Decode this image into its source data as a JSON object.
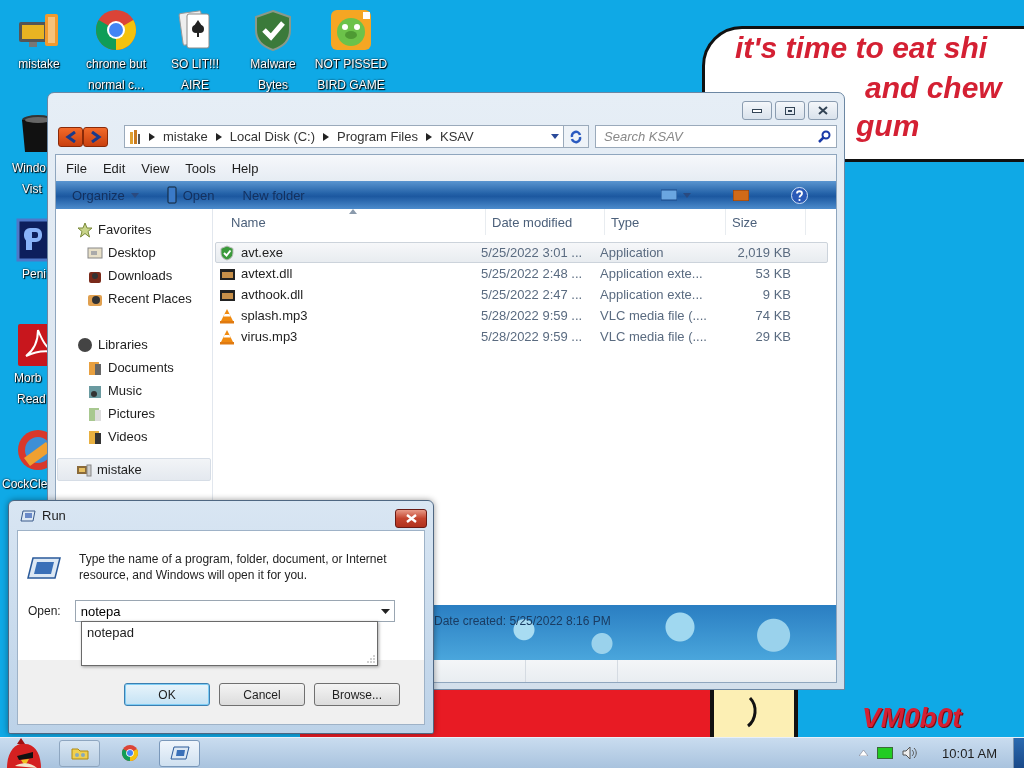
{
  "wallpaper": {
    "bubble_lines": [
      "it's time to eat shi",
      "and chew",
      "gum"
    ],
    "signature": "VM0b0t"
  },
  "desktop_icons": [
    {
      "kind": "computer",
      "lines": [
        "mistake"
      ]
    },
    {
      "kind": "chrome",
      "lines": [
        "chrome but",
        "normal c..."
      ]
    },
    {
      "kind": "cards",
      "lines": [
        "SO LIT!!!",
        "AIRE"
      ]
    },
    {
      "kind": "shield",
      "lines": [
        "Malware",
        "Bytes"
      ]
    },
    {
      "kind": "pig",
      "lines": [
        "NOT PISSED",
        "BIRD GAME"
      ]
    },
    {
      "kind": "bin",
      "lines": [
        "Windo",
        "Vist"
      ]
    },
    {
      "kind": "ps",
      "lines": [
        "Peni"
      ]
    },
    {
      "kind": "pdf",
      "lines": [
        "Morb",
        "Read"
      ]
    },
    {
      "kind": "cleaner",
      "lines": [
        "CockCle"
      ]
    }
  ],
  "explorer": {
    "breadcrumb": [
      "mistake",
      "Local Disk (C:)",
      "Program Files",
      "KSAV"
    ],
    "search": {
      "placeholder": "Search KSAV"
    },
    "menu": [
      "File",
      "Edit",
      "View",
      "Tools",
      "Help"
    ],
    "toolbar": [
      {
        "label": "Organize",
        "kind": "menu"
      },
      {
        "label": "Open",
        "kind": "open"
      },
      {
        "label": "New folder",
        "kind": "plain"
      }
    ],
    "nav": [
      {
        "label": "Favorites",
        "kind": "star",
        "selected": false,
        "children": [
          {
            "label": "Desktop",
            "kind": "desktop",
            "selected": false
          },
          {
            "label": "Downloads",
            "kind": "downloads",
            "selected": false
          },
          {
            "label": "Recent Places",
            "kind": "recent",
            "selected": false
          }
        ]
      },
      {
        "label": "Libraries",
        "kind": "libraries",
        "selected": false,
        "children": [
          {
            "label": "Documents",
            "kind": "documents",
            "selected": false
          },
          {
            "label": "Music",
            "kind": "music",
            "selected": false
          },
          {
            "label": "Pictures",
            "kind": "pictures",
            "selected": false
          },
          {
            "label": "Videos",
            "kind": "videos",
            "selected": false
          }
        ]
      },
      {
        "label": "mistake",
        "kind": "computer",
        "selected": true
      }
    ],
    "columns": [
      "Name",
      "Date modified",
      "Type",
      "Size"
    ],
    "files": [
      {
        "name": "avt.exe",
        "date": "5/25/2022 3:01 ...",
        "type": "Application",
        "size": "2,019 KB",
        "kind": "exe",
        "selected": true
      },
      {
        "name": "avtext.dll",
        "date": "5/25/2022 2:48 ...",
        "type": "Application exte...",
        "size": "53 KB",
        "kind": "dll",
        "selected": false
      },
      {
        "name": "avthook.dll",
        "date": "5/25/2022 2:47 ...",
        "type": "Application exte...",
        "size": "9 KB",
        "kind": "dll",
        "selected": false
      },
      {
        "name": "splash.mp3",
        "date": "5/28/2022 9:59 ...",
        "type": "VLC media file (....",
        "size": "74 KB",
        "kind": "mp3",
        "selected": false
      },
      {
        "name": "virus.mp3",
        "date": "5/28/2022 9:59 ...",
        "type": "VLC media file (....",
        "size": "29 KB",
        "kind": "mp3",
        "selected": false
      }
    ],
    "details": "Date created: 5/25/2022 8:16 PM"
  },
  "run": {
    "title": "Run",
    "message": "Type the name of a program, folder, document, or Internet resource, and Windows will open it for you.",
    "open_label": "Open:",
    "value": "notepa",
    "suggestions": [
      "notepad"
    ],
    "buttons": [
      {
        "label": "OK",
        "default": true
      },
      {
        "label": "Cancel",
        "default": false
      },
      {
        "label": "Browse...",
        "default": false
      }
    ]
  },
  "taskbar": {
    "buttons": [
      {
        "kind": "explorer",
        "open": true,
        "selected": false
      },
      {
        "kind": "chrome",
        "open": false,
        "selected": false
      },
      {
        "kind": "run",
        "open": true,
        "selected": true
      }
    ],
    "clock": "10:01 AM"
  }
}
